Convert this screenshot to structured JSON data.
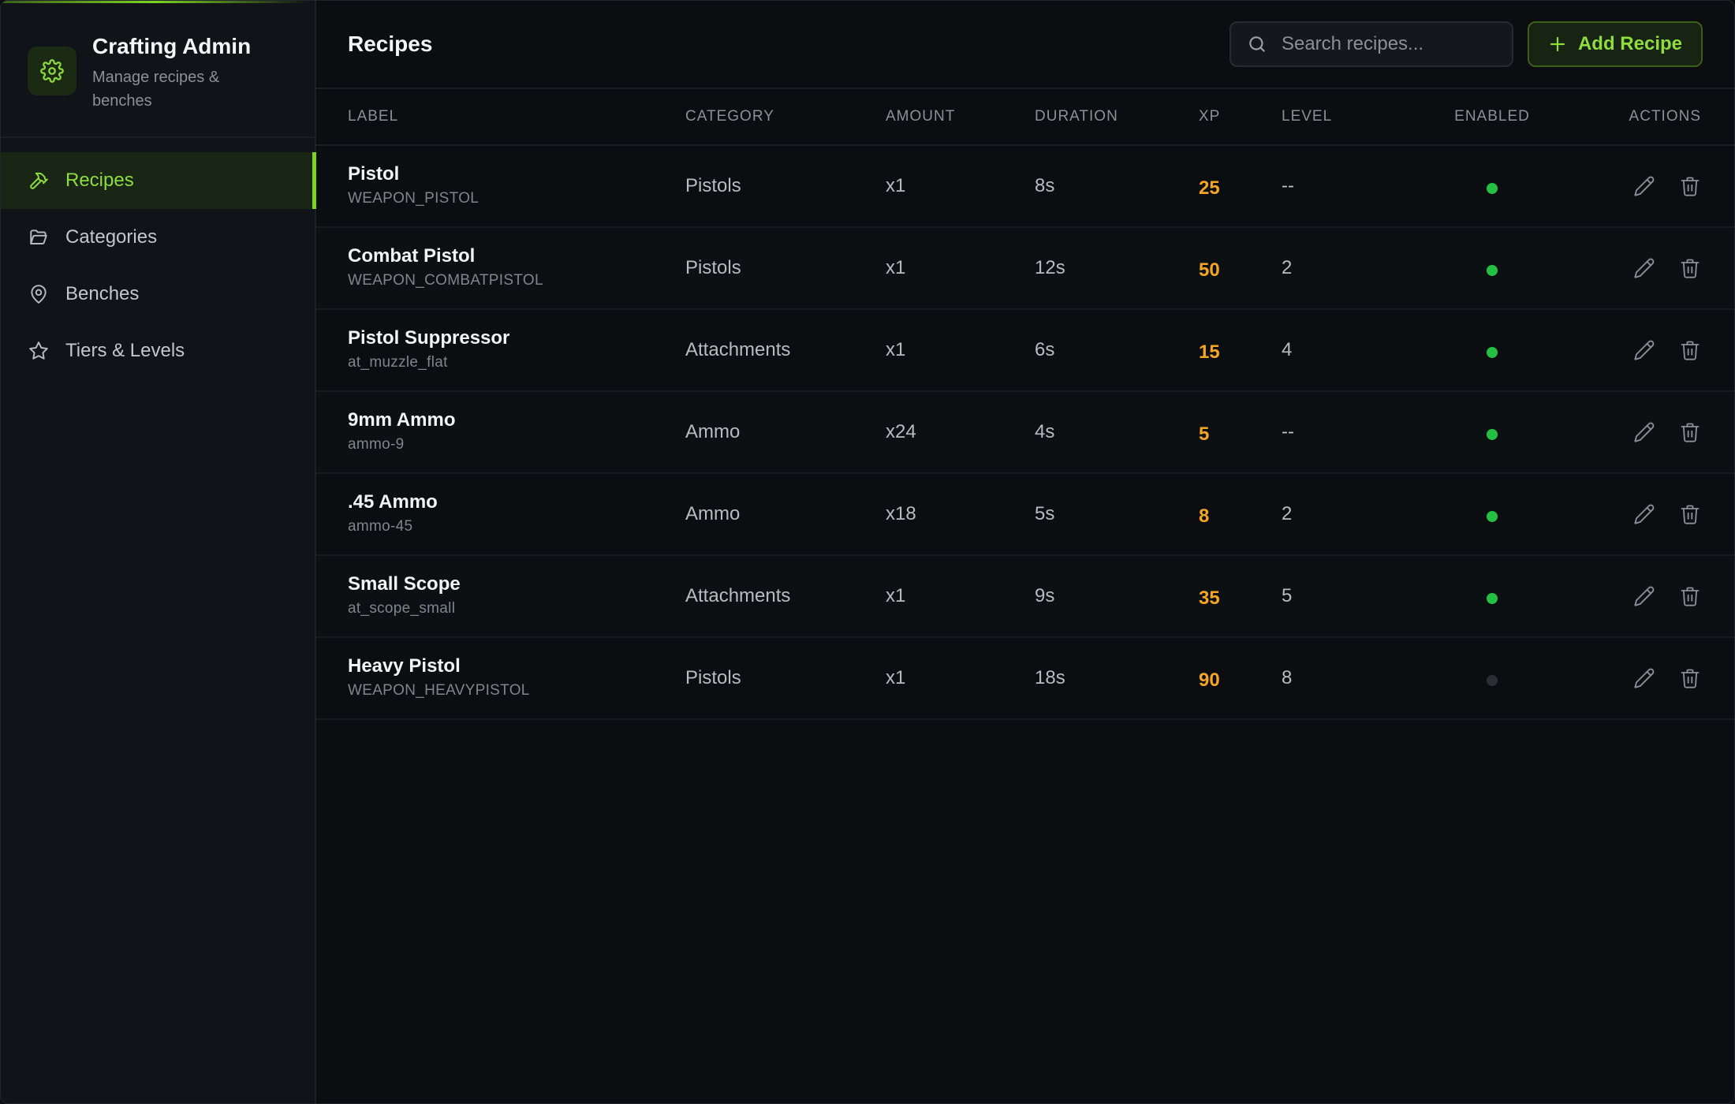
{
  "app": {
    "title": "Crafting Admin",
    "subtitle": "Manage recipes & benches",
    "accent": "#7ed321"
  },
  "sidebar": {
    "items": [
      {
        "label": "Recipes",
        "icon": "hammer-icon",
        "active": true
      },
      {
        "label": "Categories",
        "icon": "folder-icon",
        "active": false
      },
      {
        "label": "Benches",
        "icon": "map-pin-icon",
        "active": false
      },
      {
        "label": "Tiers & Levels",
        "icon": "star-icon",
        "active": false
      }
    ]
  },
  "header": {
    "title": "Recipes",
    "search_placeholder": "Search recipes...",
    "add_label": "Add Recipe"
  },
  "table": {
    "columns": [
      "LABEL",
      "CATEGORY",
      "AMOUNT",
      "DURATION",
      "XP",
      "LEVEL",
      "ENABLED",
      "ACTIONS"
    ],
    "rows": [
      {
        "label": "Pistol",
        "code": "WEAPON_PISTOL",
        "category": "Pistols",
        "amount": "x1",
        "duration": "8s",
        "xp": "25",
        "level": "--",
        "enabled": true
      },
      {
        "label": "Combat Pistol",
        "code": "WEAPON_COMBATPISTOL",
        "category": "Pistols",
        "amount": "x1",
        "duration": "12s",
        "xp": "50",
        "level": "2",
        "enabled": true
      },
      {
        "label": "Pistol Suppressor",
        "code": "at_muzzle_flat",
        "category": "Attachments",
        "amount": "x1",
        "duration": "6s",
        "xp": "15",
        "level": "4",
        "enabled": true
      },
      {
        "label": "9mm Ammo",
        "code": "ammo-9",
        "category": "Ammo",
        "amount": "x24",
        "duration": "4s",
        "xp": "5",
        "level": "--",
        "enabled": true
      },
      {
        "label": ".45 Ammo",
        "code": "ammo-45",
        "category": "Ammo",
        "amount": "x18",
        "duration": "5s",
        "xp": "8",
        "level": "2",
        "enabled": true
      },
      {
        "label": "Small Scope",
        "code": "at_scope_small",
        "category": "Attachments",
        "amount": "x1",
        "duration": "9s",
        "xp": "35",
        "level": "5",
        "enabled": true
      },
      {
        "label": "Heavy Pistol",
        "code": "WEAPON_HEAVYPISTOL",
        "category": "Pistols",
        "amount": "x1",
        "duration": "18s",
        "xp": "90",
        "level": "8",
        "enabled": false
      }
    ]
  },
  "colors": {
    "xp": "#f5a524",
    "enabled_on": "#23c043",
    "enabled_off": "#2a2f36"
  }
}
